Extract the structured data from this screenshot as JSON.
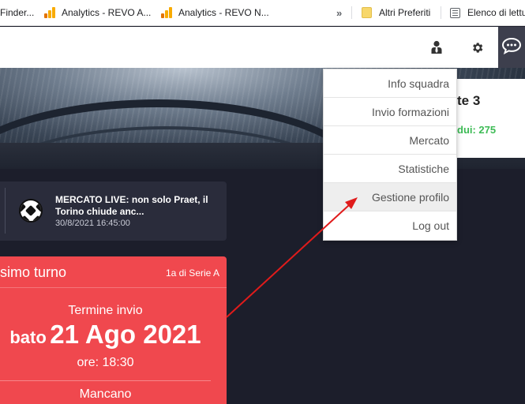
{
  "bookmarks": {
    "items": [
      {
        "label": "Finder..."
      },
      {
        "label": "Analytics - REVO A..."
      },
      {
        "label": "Analytics - REVO N..."
      }
    ],
    "overflow": "»",
    "other_favorites": "Altri Preferiti",
    "reading_list": "Elenco di lettu"
  },
  "header": {
    "icons": [
      "user-tie-icon",
      "gear-icon",
      "chat-bubble-icon"
    ]
  },
  "info_card": {
    "title": "te 3",
    "stat": "dui: 275"
  },
  "news": {
    "title": "MERCATO LIVE: non solo Praet, il Torino chiude anc...",
    "time": "30/8/2021 16:45:00"
  },
  "turn": {
    "title": "simo turno",
    "badge": "1a di Serie A",
    "deadline_label": "Termine invio",
    "day": "bato",
    "date": "21 Ago 2021",
    "time": "ore: 18:30",
    "remaining_label": "Mancano"
  },
  "menu": {
    "items": [
      {
        "label": "Info squadra"
      },
      {
        "label": "Invio formazioni"
      },
      {
        "label": "Mercato"
      },
      {
        "label": "Statistiche"
      },
      {
        "label": "Gestione profilo"
      },
      {
        "label": "Log out"
      }
    ],
    "highlighted_index": 4
  },
  "colors": {
    "accent_red": "#f0484e",
    "stat_green": "#3dbb55",
    "dark_bg": "#1c1e2b",
    "arrow": "#e01b1b"
  }
}
